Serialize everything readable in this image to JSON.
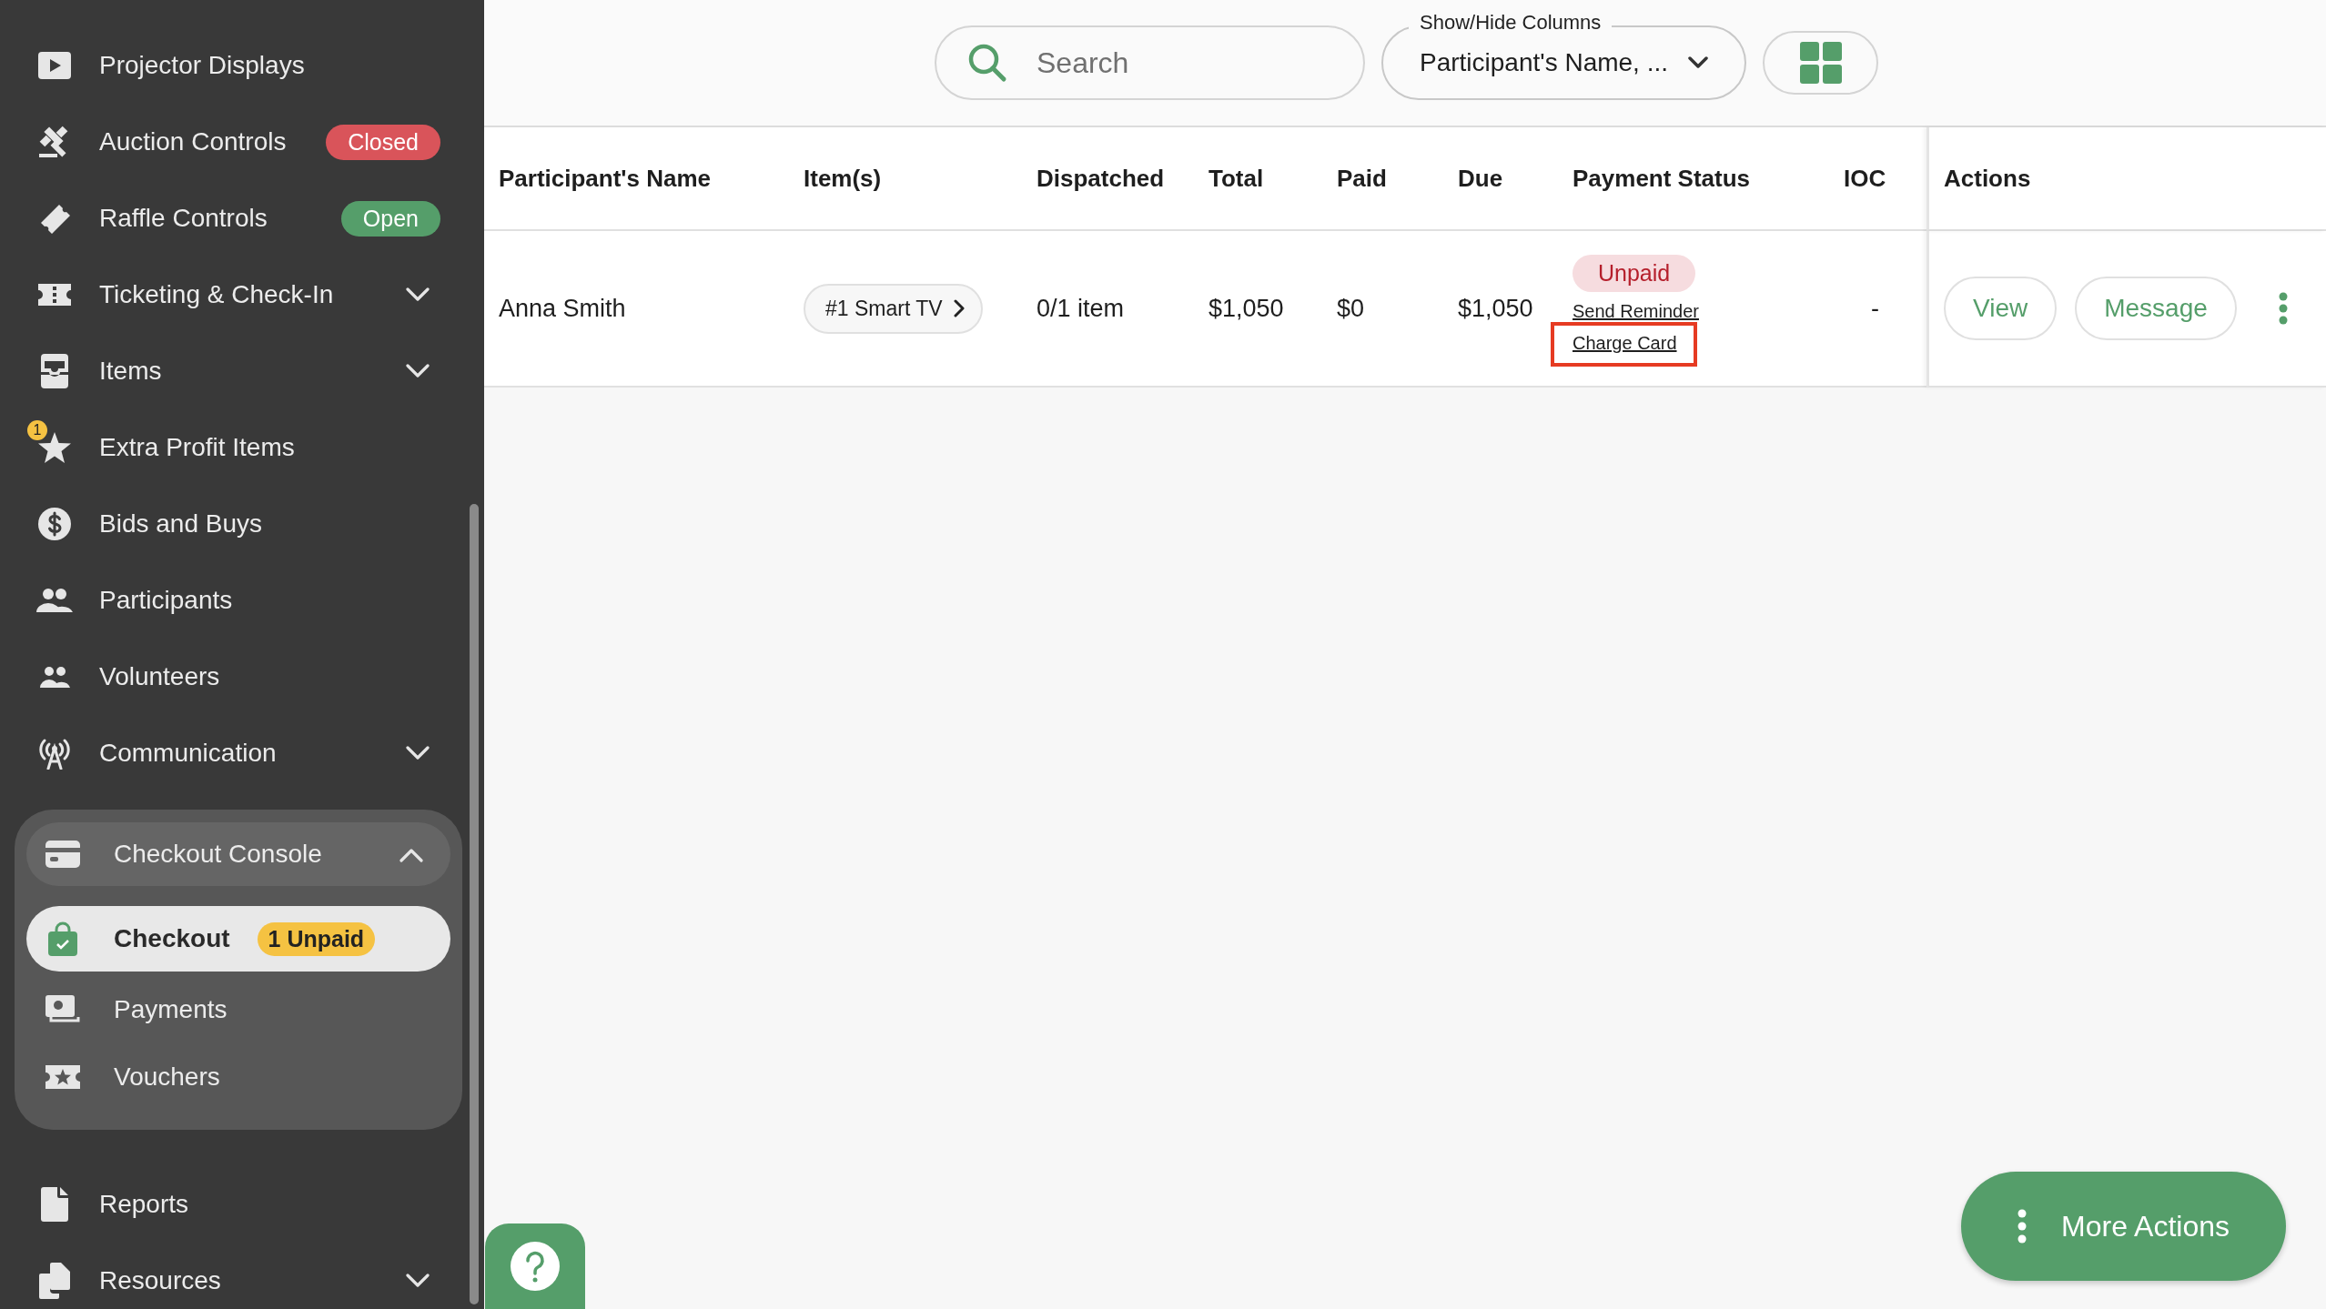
{
  "sidebar": {
    "items": [
      {
        "kind": "link",
        "label": "Projector Displays",
        "selected": false
      },
      {
        "kind": "link",
        "label": "Auction Controls",
        "selected": false,
        "badge": {
          "text": "Closed",
          "color": "#d9545a"
        }
      },
      {
        "kind": "link",
        "label": "Raffle Controls",
        "selected": false,
        "badge": {
          "text": "Open",
          "color": "#559e6a"
        }
      },
      {
        "kind": "link",
        "label": "Ticketing & Check-In",
        "selected": false,
        "expanded": false
      },
      {
        "kind": "link",
        "label": "Items",
        "selected": false,
        "expanded": false
      },
      {
        "kind": "link",
        "label": "Extra Profit Items",
        "selected": false,
        "count": "1"
      },
      {
        "kind": "link",
        "label": "Bids and Buys",
        "selected": false
      },
      {
        "kind": "link",
        "label": "Participants",
        "selected": false
      },
      {
        "kind": "link",
        "label": "Volunteers",
        "selected": false
      },
      {
        "kind": "link",
        "label": "Communication",
        "selected": false,
        "expanded": false
      },
      {
        "kind": "group",
        "label": "Checkout Console",
        "selected": false,
        "expanded": true,
        "children": [
          {
            "label": "Checkout",
            "selected": true,
            "badge": {
              "text": "1 Unpaid",
              "color": "#f5c242"
            }
          },
          {
            "label": "Payments",
            "selected": false
          },
          {
            "label": "Vouchers",
            "selected": false
          }
        ]
      },
      {
        "kind": "link",
        "label": "Reports",
        "selected": false
      },
      {
        "kind": "link",
        "label": "Resources",
        "selected": false,
        "expanded": false
      }
    ]
  },
  "toolbar": {
    "search": {
      "placeholder": "Search"
    },
    "columns_select": {
      "label": "Show/Hide Columns",
      "value": "Participant's Name, ..."
    }
  },
  "table": {
    "columns": [
      "Participant's Name",
      "Item(s)",
      "Dispatched",
      "Total",
      "Paid",
      "Due",
      "Payment Status",
      "IOC",
      "Actions"
    ],
    "rows": [
      {
        "name": "Anna Smith",
        "items": "#1 Smart TV",
        "dispatched": "0/1 item",
        "total": "$1,050",
        "paid": "$0",
        "due": "$1,050",
        "payment_status": {
          "label": "Unpaid",
          "links": [
            {
              "label": "Send Reminder",
              "highlighted": false
            },
            {
              "label": "Charge Card",
              "highlighted": true
            }
          ]
        },
        "ioc": "-",
        "actions": [
          "View",
          "Message"
        ]
      }
    ]
  },
  "more_actions": {
    "label": "More Actions"
  }
}
